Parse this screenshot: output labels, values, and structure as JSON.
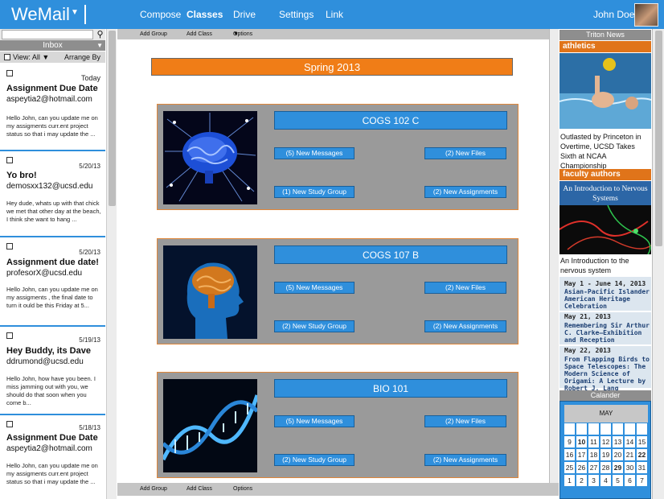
{
  "app": {
    "title": "WeMail"
  },
  "nav": {
    "compose": "Compose",
    "classes": "Classes",
    "drive": "Drive",
    "settings": "Settings",
    "link": "Link"
  },
  "user": {
    "name": "John Doe"
  },
  "inbox": {
    "header": "Inbox",
    "view_label": "View: All",
    "arrange_label": "Arrange By",
    "messages": [
      {
        "date": "Today",
        "subject": "Assignment Due Date",
        "from": "aspeytia2@hotmail.com",
        "preview": "Hello John, can you update me on my assigments curr.ent project status so that i may update the ..."
      },
      {
        "date": "5/20/13",
        "subject": "Yo bro!",
        "from": "demosxx132@ucsd.edu",
        "preview": "Hey dude, whats up with that chick we met that other day at the beach, I think she want to hang ..."
      },
      {
        "date": "5/20/13",
        "subject": "Assignment due date!",
        "from": "profesorX@ucsd.edu",
        "preview": "Hello John, can you update me on my assigments , the final date to turn it ould be this Friday at 5..."
      },
      {
        "date": "5/19/13",
        "subject": "Hey Buddy, its Dave",
        "from": "ddrumond@ucsd.edu",
        "preview": "Hello John,  how have you been.  I miss jamming out with you, we should do that soon when you come b..."
      },
      {
        "date": "5/18/13",
        "subject": "Assignment Due Date",
        "from": "aspeytia2@hotmail.com",
        "preview": "Hello John, can you update me on my assigments curr.ent project status so that i may update the ..."
      }
    ]
  },
  "toolbar": {
    "add_group": "Add Group",
    "add_class": "Add Class",
    "options": "Options"
  },
  "semester": "Spring 2013",
  "courses": [
    {
      "title": "COGS 102 C",
      "new_messages": "(5)  New Messages",
      "new_files": "(2)  New Files",
      "new_study_group": "(1)  New Study Group",
      "new_assignments": "(2)  New Assignments"
    },
    {
      "title": "COGS 107 B",
      "new_messages": "(5)  New Messages",
      "new_files": "(2)  New Files",
      "new_study_group": "(2)  New Study Group",
      "new_assignments": "(2)  New Assignments"
    },
    {
      "title": "BIO 101",
      "new_messages": "(5)  New Messages",
      "new_files": "(2)  New Files",
      "new_study_group": "(2)  New Study Group",
      "new_assignments": "(2)  New Assignments"
    }
  ],
  "news": {
    "header": "Triton News",
    "athletics": {
      "category": "athletics",
      "caption": "Outlasted by Princeton in Overtime, UCSD Takes Sixth at NCAA Championship"
    },
    "faculty": {
      "category": "faculty authors",
      "book_title": "An Introduction to Nervous Systems",
      "caption": "An Introduction to the nervous system"
    },
    "events": [
      {
        "date": "May 1 - June 14, 2013",
        "title": "Asian-Pacific Islander American Heritage Celebration"
      },
      {
        "date": "May 21, 2013",
        "title": "Remembering Sir Arthur C. Clarke—Exhibition and Reception"
      },
      {
        "date": "May 22, 2013",
        "title": "From Flapping Birds to Space Telescopes: The Modern Science of Origami: A Lecture by Robert J. Lang"
      }
    ]
  },
  "calendar": {
    "header": "Calander",
    "month": "MAY",
    "rows": [
      [
        "2",
        "3",
        "4",
        "5",
        "6",
        "7",
        "8"
      ],
      [
        "9",
        "10",
        "11",
        "12",
        "13",
        "14",
        "15"
      ],
      [
        "16",
        "17",
        "18",
        "19",
        "20",
        "21",
        "22"
      ],
      [
        "23",
        "24",
        "25",
        "26",
        "27",
        "28",
        "29"
      ],
      [
        "30",
        "1",
        "2",
        "3",
        "4",
        "5",
        "6"
      ],
      [
        "7",
        "8",
        "9",
        "10",
        "11",
        "12",
        "13"
      ]
    ],
    "bold_days": [
      "10",
      "22",
      "29"
    ],
    "visible_rows": [
      [
        "",
        "",
        "",
        "",
        "",
        "",
        ""
      ],
      [
        "9",
        "10",
        "11",
        "12",
        "13",
        "14",
        "15"
      ],
      [
        "16",
        "17",
        "18",
        "19",
        "20",
        "21",
        "22"
      ],
      [
        "25",
        "26",
        "27",
        "28",
        "29",
        "30",
        "31"
      ],
      [
        "1",
        "2",
        "3",
        "4",
        "5",
        "6",
        "7"
      ]
    ]
  },
  "colors": {
    "brand_blue": "#2f8fdc",
    "accent_orange": "#f07d17",
    "panel_gray": "#9a9a9a"
  }
}
